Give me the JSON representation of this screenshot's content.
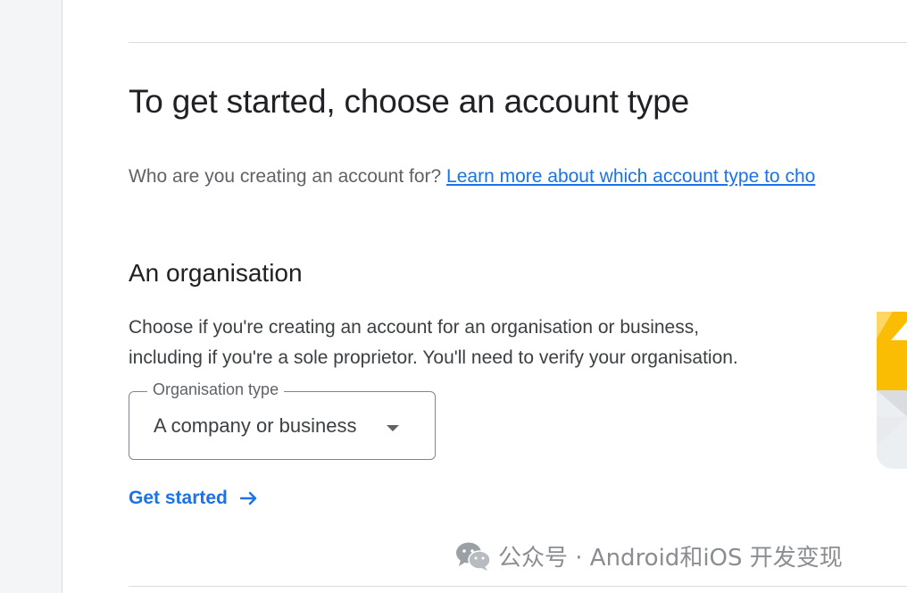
{
  "page": {
    "heading": "To get started, choose an account type",
    "question": "Who are you creating an account for?",
    "learn_more_link": "Learn more about which account type to cho",
    "section": {
      "title": "An organisation",
      "description_line1": "Choose if you're creating an account for an organisation or business,",
      "description_line2": "including if you're a sole proprietor. You'll need to verify your organisation.",
      "field_label": "Organisation type",
      "field_value": "A company or business",
      "cta_label": "Get started"
    }
  },
  "watermark": {
    "text": "公众号 · Android和iOS 开发变现"
  },
  "colors": {
    "link": "#1a73e8",
    "illustration_yellow": "#fbbc04"
  },
  "icons": {
    "dropdown": "dropdown-arrow-icon",
    "cta": "arrow-right-icon",
    "watermark": "wechat-icon"
  }
}
